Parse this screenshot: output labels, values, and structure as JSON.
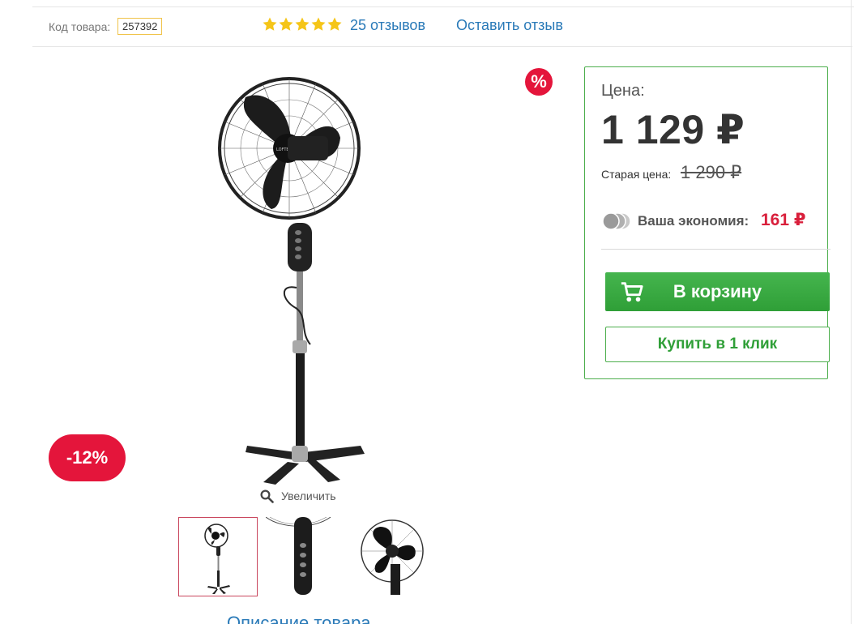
{
  "info_bar": {
    "sku_label": "Код товара:",
    "sku_value": "257392",
    "rating_stars": 5,
    "reviews_link": "25 отзывов",
    "leave_review": "Оставить отзыв"
  },
  "gallery": {
    "percent_badge": "%",
    "discount_badge": "-12%",
    "zoom_label": "Увеличить",
    "thumbnail_count": 3,
    "active_thumbnail": 0
  },
  "price_box": {
    "price_label": "Цена:",
    "price_value": "1 129 ₽",
    "old_price_label": "Старая цена:",
    "old_price": "1 290 ₽",
    "savings_label": "Ваша экономия:",
    "savings_value": "161 ₽",
    "cart_button": "В корзину",
    "one_click_button": "Купить в 1 клик"
  },
  "tabs": {
    "description_tab": "Описание товара"
  },
  "colors": {
    "accent_green": "#3aa843",
    "badge_red": "#e4153b",
    "link_blue": "#2a7ab8",
    "star_gold": "#f5c518"
  },
  "icons": {
    "star": "star-icon",
    "zoom": "magnifier-icon",
    "cart": "cart-icon",
    "coins": "coins-icon"
  }
}
